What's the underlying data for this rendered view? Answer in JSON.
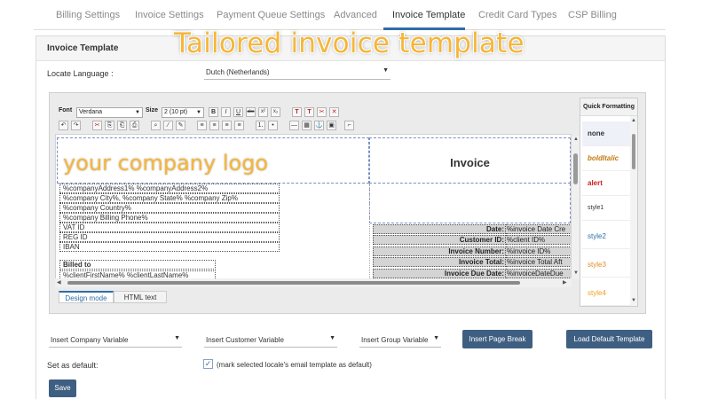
{
  "tabs": [
    {
      "label": "Billing Settings",
      "active": false
    },
    {
      "label": "Invoice Settings",
      "active": false
    },
    {
      "label": "Payment Queue Settings",
      "active": false
    },
    {
      "label": "Advanced",
      "active": false
    },
    {
      "label": "Invoice Template",
      "active": true
    },
    {
      "label": "Credit Card Types",
      "active": false
    },
    {
      "label": "CSP Billing",
      "active": false
    }
  ],
  "panel": {
    "title": "Invoice Template"
  },
  "overlay_title": "Tailored invoice template",
  "locale": {
    "label": "Locate Language :",
    "value": "Dutch (Netherlands)"
  },
  "toolbar": {
    "font_label": "Font",
    "font_value": "Verdana",
    "size_label": "Size",
    "size_value": "2 (10 pt)",
    "row1_buttons": [
      {
        "text": "B",
        "icon": "bold-icon"
      },
      {
        "text": "I",
        "icon": "italic-icon"
      },
      {
        "text": "U",
        "icon": "underline-icon"
      },
      {
        "text": "abc",
        "icon": "strikethrough-icon"
      },
      {
        "text": "x²",
        "icon": "superscript-icon"
      },
      {
        "text": "x₂",
        "icon": "subscript-icon"
      },
      {
        "text": "T",
        "icon": "text-color-icon"
      },
      {
        "text": "T",
        "icon": "remove-format-icon"
      },
      {
        "text": "✂",
        "icon": "cleanup-icon"
      },
      {
        "text": "✕",
        "icon": "clear-styles-icon"
      }
    ],
    "row2_buttons": [
      {
        "text": "↶",
        "icon": "undo-icon"
      },
      {
        "text": "↷",
        "icon": "redo-icon"
      },
      {
        "text": "✂",
        "icon": "cut-icon"
      },
      {
        "text": "⎘",
        "icon": "copy-icon"
      },
      {
        "text": "⎗",
        "icon": "paste-icon"
      },
      {
        "text": "⎙",
        "icon": "paste-text-icon"
      },
      {
        "text": "⌕",
        "icon": "find-icon"
      },
      {
        "text": "⁄",
        "icon": "eyedropper-icon"
      },
      {
        "text": "✎",
        "icon": "pen-icon"
      },
      {
        "text": "≡",
        "icon": "align-left-icon"
      },
      {
        "text": "≡",
        "icon": "align-center-icon"
      },
      {
        "text": "≡",
        "icon": "align-right-icon"
      },
      {
        "text": "≡",
        "icon": "justify-icon"
      },
      {
        "text": "⒈",
        "icon": "ordered-list-icon"
      },
      {
        "text": "•",
        "icon": "unordered-list-icon"
      },
      {
        "text": "—",
        "icon": "horizontal-rule-icon"
      },
      {
        "text": "▦",
        "icon": "table-icon"
      },
      {
        "text": "⚓",
        "icon": "anchor-icon"
      },
      {
        "text": "▣",
        "icon": "image-icon"
      },
      {
        "text": "⌐",
        "icon": "link-icon"
      }
    ]
  },
  "template": {
    "logo_text": "your company logo",
    "invoice_word": "Invoice",
    "address_lines": [
      "%companyAddress1% %companyAddress2%",
      "%company City%, %company State% %company Zip%",
      "%company Country%",
      "%company Billing Phone%",
      "VAT ID",
      "REG ID",
      "IBAN"
    ],
    "billed_to": "Billed to",
    "client_name": "%clientFirstName% %clientLastName%",
    "invoice_rows": [
      {
        "label": "Date:",
        "value": "%invoice Date Cre",
        "bold": false
      },
      {
        "label": "Customer ID:",
        "value": "%client ID%",
        "bold": true
      },
      {
        "label": "Invoice Number:",
        "value": "%invoice ID%",
        "bold": true
      },
      {
        "label": "Invoice Total:",
        "value": "%invoice Total Aft",
        "bold": true
      },
      {
        "label": "Invoice Due Date:",
        "value": "%invoiceDateDue",
        "bold": true
      }
    ]
  },
  "mode_tabs": [
    {
      "label": "Design mode",
      "active": true
    },
    {
      "label": "HTML text",
      "active": false
    }
  ],
  "quick_formatting": {
    "title": "Quick Formatting",
    "items": [
      {
        "label": "none",
        "color": "#222222",
        "style": "bold"
      },
      {
        "label": "boldItalic",
        "color": "#c47a12",
        "style": "bolditalic"
      },
      {
        "label": "alert",
        "color": "#d11f1f",
        "style": "bold"
      },
      {
        "label": "style1",
        "color": "#222222",
        "style": "small"
      },
      {
        "label": "style2",
        "color": "#2d6ea8",
        "style": "normal"
      },
      {
        "label": "style3",
        "color": "#e08a2a",
        "style": "normal"
      },
      {
        "label": "style4",
        "color": "#f0a020",
        "style": "normal"
      }
    ]
  },
  "variables": {
    "company": "Insert Company Variable",
    "customer": "Insert Customer Variable",
    "group": "Insert Group Variable"
  },
  "buttons": {
    "page_break": "Insert Page Break",
    "load_default": "Load Default Template",
    "save": "Save"
  },
  "default": {
    "label": "Set as default:",
    "checked": true,
    "checkbox_text": "(mark selected locale's email template as default)"
  },
  "colors": {
    "accent": "#2d6ea8",
    "button": "#3f5f82",
    "overlay": "#f6b638"
  }
}
